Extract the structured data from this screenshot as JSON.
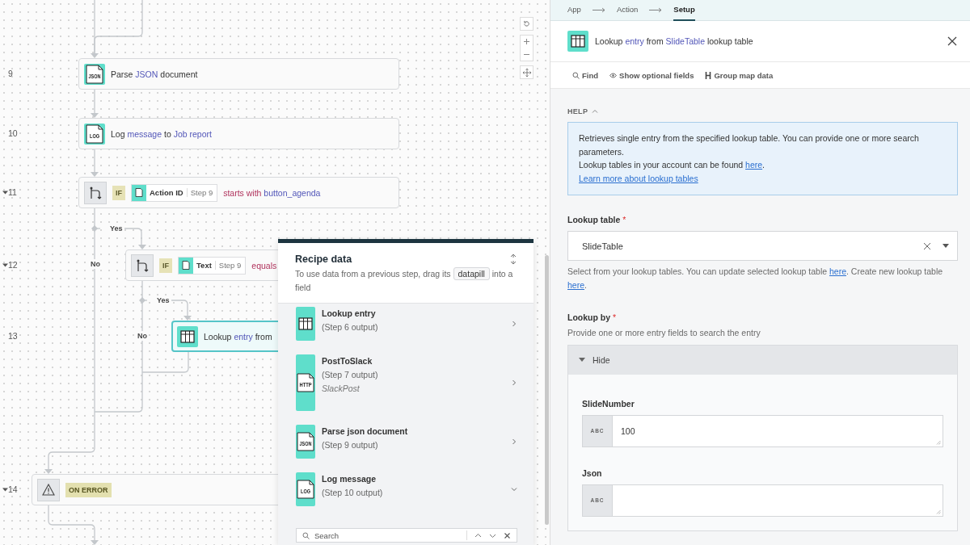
{
  "canvas": {
    "steps": [
      {
        "number": "9",
        "kind": "action",
        "icon_text": "JSON",
        "selected": false,
        "text": [
          {
            "text": "Parse "
          },
          {
            "text": "JSON",
            "kind": "field"
          },
          {
            "text": " document"
          }
        ]
      },
      {
        "number": "10",
        "kind": "action",
        "icon_text": "LOG",
        "selected": false,
        "text": [
          {
            "text": "Log "
          },
          {
            "text": "message",
            "kind": "field"
          },
          {
            "text": " to "
          },
          {
            "text": "Job report",
            "kind": "field"
          }
        ]
      },
      {
        "number": "11",
        "kind": "if",
        "expanded": true,
        "selected": false,
        "badge": "IF",
        "pill": {
          "label": "Action ID",
          "step": "Step 9"
        },
        "text": [
          {
            "text": "starts with ",
            "kind": "operator"
          },
          {
            "text": "button_agenda",
            "kind": "field"
          }
        ],
        "branches": [
          {
            "label": "Yes"
          },
          {
            "label": "No"
          }
        ]
      },
      {
        "number": "12",
        "kind": "if",
        "expanded": true,
        "selected": false,
        "badge": "IF",
        "pill": {
          "label": "Text",
          "step": "Step 9"
        },
        "text": [
          {
            "text": "equals",
            "kind": "operator"
          }
        ],
        "branches": [
          {
            "label": "Yes"
          },
          {
            "label": "No"
          }
        ]
      },
      {
        "number": "13",
        "kind": "action",
        "selected": true,
        "text": [
          {
            "text": "Lookup "
          },
          {
            "text": "entry",
            "kind": "field"
          },
          {
            "text": " from"
          }
        ]
      },
      {
        "number": "14",
        "kind": "error",
        "expanded": true,
        "selected": false,
        "badge": "ON ERROR"
      }
    ]
  },
  "recipe_data": {
    "title": "Recipe data",
    "description": [
      {
        "text": "To use data from a previous step, drag its "
      },
      {
        "text": "datapill",
        "kind": "pill"
      },
      {
        "text": " into a field"
      }
    ],
    "items": [
      {
        "title": "Lookup entry",
        "subtitle": "(Step 6 output)",
        "expanded": false
      },
      {
        "title": "PostToSlack",
        "subtitle": "(Step 7 output)",
        "note": "SlackPost",
        "icon_text": "HTTP",
        "expanded": false
      },
      {
        "title": "Parse json document",
        "subtitle": "(Step 9 output)",
        "icon_text": "JSON",
        "expanded": false
      },
      {
        "title": "Log message",
        "subtitle": "(Step 10 output)",
        "icon_text": "LOG",
        "expanded": true
      }
    ],
    "search": {
      "placeholder": "Search"
    }
  },
  "panel": {
    "wizard": [
      {
        "label": "App",
        "selected": false
      },
      {
        "label": "Action",
        "selected": false
      },
      {
        "label": "Setup",
        "selected": true
      }
    ],
    "title": [
      {
        "text": "Lookup "
      },
      {
        "text": "entry",
        "kind": "field"
      },
      {
        "text": " from "
      },
      {
        "text": "SlideTable",
        "kind": "field"
      },
      {
        "text": " lookup table"
      }
    ],
    "toolbar": [
      {
        "label": "Find"
      },
      {
        "label": "Show optional fields"
      },
      {
        "label": "Group map data"
      }
    ],
    "help": {
      "heading": "HELP",
      "expanded": true,
      "paragraphs": [
        [
          {
            "text": "Retrieves single entry from the specified lookup table. You can provide one or more search parameters."
          }
        ],
        [
          {
            "text": "Lookup tables in your account can be found "
          },
          {
            "text": "here",
            "kind": "link"
          },
          {
            "text": "."
          }
        ],
        [
          {
            "text": "Learn more about lookup tables",
            "kind": "link"
          }
        ]
      ]
    },
    "lookup_table": {
      "label": "Lookup table",
      "required_mark": "*",
      "value": "SlideTable",
      "hint": [
        {
          "text": "Select from your lookup tables. You can update selected lookup table "
        },
        {
          "text": "here",
          "kind": "link"
        },
        {
          "text": ". Create new lookup table "
        },
        {
          "text": "here",
          "kind": "link"
        },
        {
          "text": "."
        }
      ]
    },
    "lookup_by": {
      "label": "Lookup by",
      "required_mark": "*",
      "hint": [
        {
          "text": "Provide one or more entry fields to search the entry"
        }
      ],
      "group": {
        "toggle": "Hide",
        "expanded": true,
        "fields": [
          {
            "label": "SlideNumber",
            "type_label": "ABC",
            "value": "100"
          },
          {
            "label": "Json",
            "type_label": "ABC"
          }
        ]
      }
    }
  }
}
